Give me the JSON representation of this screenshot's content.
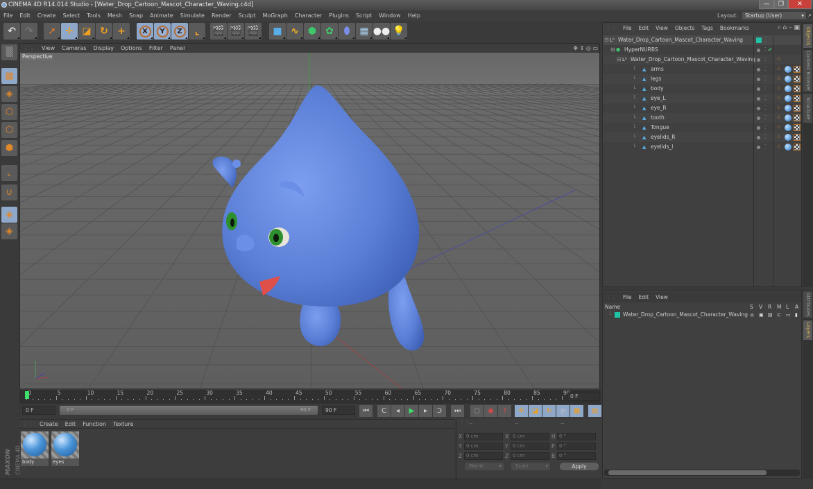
{
  "window": {
    "title": "CINEMA 4D R14.014 Studio - [Water_Drop_Cartoon_Mascot_Character_Waving.c4d]",
    "minimize": "—",
    "maximize": "❐",
    "close": "✕"
  },
  "menubar": [
    "File",
    "Edit",
    "Create",
    "Select",
    "Tools",
    "Mesh",
    "Snap",
    "Animate",
    "Simulate",
    "Render",
    "Sculpt",
    "MoGraph",
    "Character",
    "Plugins",
    "Script",
    "Window",
    "Help"
  ],
  "layout": {
    "label": "Layout:",
    "value": "Startup (User)"
  },
  "toolbar": {
    "groups": [
      [
        "undo-icon",
        "redo-icon"
      ],
      [
        "live-select-icon",
        "move-icon",
        "scale-icon",
        "rotate-icon",
        "add-icon"
      ],
      [
        "x-axis-icon",
        "y-axis-icon",
        "z-axis-icon",
        "coordinate-system-icon"
      ],
      [
        "render-view-icon",
        "render-picture-viewer-icon",
        "render-settings-icon"
      ],
      [
        "cube-icon",
        "spline-pen-icon",
        "nurbs-icon",
        "array-icon",
        "deformer-icon",
        "floor-icon",
        "camera-icon",
        "light-icon"
      ]
    ],
    "axis_labels": [
      "X",
      "Y",
      "Z"
    ]
  },
  "left_tools": [
    "make-editable-icon",
    "texture-mode-icon",
    "workplane-icon",
    "points-mode-icon",
    "edges-mode-icon",
    "polygons-mode-icon",
    "axis-mode-icon",
    "magnet-icon",
    "locked-workplane-icon",
    "workplane-snap-icon"
  ],
  "viewport": {
    "menu": [
      "View",
      "Cameras",
      "Display",
      "Options",
      "Filter",
      "Panel"
    ],
    "camera_label": "Perspective",
    "nav_icons": [
      "pan-icon",
      "dolly-icon",
      "rotate-view-icon",
      "toggle-layout-icon"
    ],
    "character_colors": {
      "body": "#5b7fd6",
      "eye_iris": "#2e8f2e",
      "tongue": "#e0504a"
    }
  },
  "timeline": {
    "ticks": [
      "0",
      "5",
      "10",
      "15",
      "20",
      "25",
      "30",
      "35",
      "40",
      "45",
      "50",
      "55",
      "60",
      "65",
      "70",
      "75",
      "80",
      "85",
      "90"
    ],
    "current_frame": "0 F",
    "start_field": "0 F",
    "range_start": "0 F",
    "range_end": "90 F",
    "end_field": "90 F",
    "playhead_fraction": 0
  },
  "transport": {
    "buttons": [
      "go-to-start-icon",
      "prev-key-icon",
      "prev-frame-icon",
      "play-icon",
      "next-frame-icon",
      "next-key-icon",
      "go-to-end-icon",
      "record-off-icon",
      "autokey-icon",
      "keyframe-selection-icon",
      "key-position-icon",
      "key-scale-icon",
      "key-rotation-icon",
      "key-parameter-icon",
      "key-pla-icon",
      "timeline-icon"
    ]
  },
  "material_panel": {
    "menu": [
      "Create",
      "Edit",
      "Function",
      "Texture"
    ],
    "materials": [
      {
        "name": "body"
      },
      {
        "name": "eyes"
      }
    ],
    "brand": "MAXON",
    "brand_sub": "CINEMA 4D"
  },
  "coord_panel": {
    "headers": [
      "--",
      "--",
      "--"
    ],
    "rows": [
      {
        "pos_label": "X",
        "pos": "0 cm",
        "size_label": "X",
        "size": "0 cm",
        "rot_label": "H",
        "rot": "0 °"
      },
      {
        "pos_label": "Y",
        "pos": "0 cm",
        "size_label": "Y",
        "size": "0 cm",
        "rot_label": "P",
        "rot": "0 °"
      },
      {
        "pos_label": "Z",
        "pos": "0 cm",
        "size_label": "Z",
        "size": "0 cm",
        "rot_label": "B",
        "rot": "0 °"
      }
    ],
    "space": "World",
    "mode": "Scale",
    "apply": "Apply"
  },
  "object_manager": {
    "menu": [
      "File",
      "Edit",
      "View",
      "Objects",
      "Tags",
      "Bookmarks"
    ],
    "objects": [
      {
        "name": "Water_Drop_Cartoon_Mascot_Character_Waving",
        "type": "null",
        "depth": 0
      },
      {
        "name": "HyperNURBS",
        "type": "hypernurbs",
        "depth": 1
      },
      {
        "name": "Water_Drop_Cartoon_Mascot_Character_Waving",
        "type": "null",
        "depth": 2
      },
      {
        "name": "arms",
        "type": "polygon",
        "depth": 3
      },
      {
        "name": "legs",
        "type": "polygon",
        "depth": 3
      },
      {
        "name": "body",
        "type": "polygon",
        "depth": 3
      },
      {
        "name": "eye_L",
        "type": "polygon",
        "depth": 3
      },
      {
        "name": "eye_R",
        "type": "polygon",
        "depth": 3
      },
      {
        "name": "tooth",
        "type": "polygon",
        "depth": 3
      },
      {
        "name": "Tongue",
        "type": "polygon",
        "depth": 3
      },
      {
        "name": "eyelids_R",
        "type": "polygon",
        "depth": 3
      },
      {
        "name": "eyelids_l",
        "type": "polygon",
        "depth": 3
      }
    ]
  },
  "side_tabs_top": [
    "Objects",
    "Content Browser",
    "Structure"
  ],
  "side_tabs_bottom": [
    "Attributes",
    "Layers"
  ],
  "layer_manager": {
    "menu": [
      "File",
      "Edit",
      "View"
    ],
    "columns": {
      "name": "Name",
      "flags": [
        "S",
        "V",
        "R",
        "M",
        "L",
        "A"
      ]
    },
    "layers": [
      {
        "name": "Water_Drop_Cartoon_Mascot_Character_Waving",
        "color": "#1fc4a6"
      }
    ]
  }
}
